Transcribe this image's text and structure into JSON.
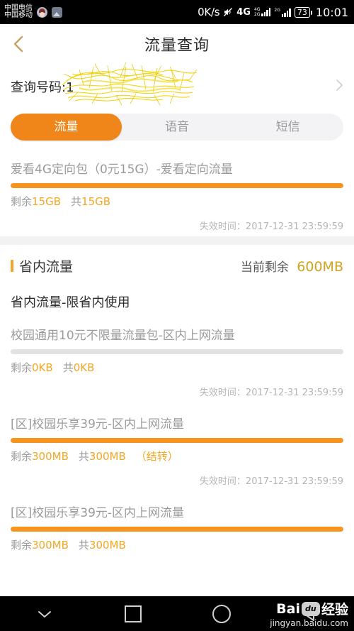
{
  "status_bar": {
    "carrier_line1": "中国电信",
    "carrier_line2": "中国移动",
    "icons": [
      "contact-avatar-icon",
      "screenshot-icon"
    ],
    "net_speed": "0K/s",
    "mute_icon": "mute-icon",
    "network_type": "4G",
    "signal_tag_top": "4G",
    "signal_tag_bottom": "2G",
    "signal_tag_second": "2G",
    "battery": "73",
    "time": "10:01"
  },
  "header": {
    "back_icon": "back-chevron-icon",
    "title": "流量查询"
  },
  "query": {
    "label": "查询号码:1",
    "redaction": "yellow-scribble-redaction",
    "chevron_icon": "chevron-right-icon"
  },
  "tabs": [
    {
      "label": "流量",
      "active": true
    },
    {
      "label": "语音",
      "active": false
    },
    {
      "label": "短信",
      "active": false
    }
  ],
  "packages_top": [
    {
      "title": "爱看4G定向包（0元15G）-爱看定向流量",
      "progress_percent": 100,
      "remaining_label": "剩余",
      "remaining_value": "15GB",
      "total_label": "共",
      "total_value": "15GB",
      "carry_over": "",
      "expiry_label": "失效时间：",
      "expiry_value": "2017-12-31 23:59:59"
    }
  ],
  "section": {
    "marker": "orange-bar-marker",
    "title": "省内流量",
    "remaining_label": "当前剩余",
    "remaining_value": "600MB",
    "subtitle": "省内流量-限省内使用"
  },
  "packages_section": [
    {
      "title": "校园通用10元不限量流量包-区内上网流量",
      "progress_percent": 0,
      "remaining_label": "剩余",
      "remaining_value": "0KB",
      "total_label": "共",
      "total_value": "0KB",
      "carry_over": "",
      "expiry_label": "失效时间：",
      "expiry_value": "2017-12-31 23:59:59"
    },
    {
      "title": "[区]校园乐享39元-区内上网流量",
      "progress_percent": 100,
      "remaining_label": "剩余",
      "remaining_value": "300MB",
      "total_label": "共",
      "total_value": "300MB",
      "carry_over": "（结转）",
      "expiry_label": "失效时间：",
      "expiry_value": "2017-12-31 23:59:59"
    },
    {
      "title": "[区]校园乐享39元-区内上网流量",
      "progress_percent": 100,
      "remaining_label": "剩余",
      "remaining_value": "300MB",
      "total_label": "共",
      "total_value": "300MB",
      "carry_over": "",
      "expiry_label": "",
      "expiry_value": ""
    }
  ],
  "nav_bar": {
    "buttons": [
      "chevron-down-icon",
      "recents-square-icon",
      "home-circle-icon",
      "back-triangle-icon"
    ],
    "watermark_title": "Bai",
    "watermark_badge": "du",
    "watermark_suffix": "经验",
    "watermark_url": "jingyan.baidu.com"
  },
  "colors": {
    "accent_orange": "#F08519",
    "progress_orange": "#F7941D",
    "value_gold": "#F5A623",
    "section_gold": "#D2A320",
    "back_chevron": "#C9A063"
  }
}
